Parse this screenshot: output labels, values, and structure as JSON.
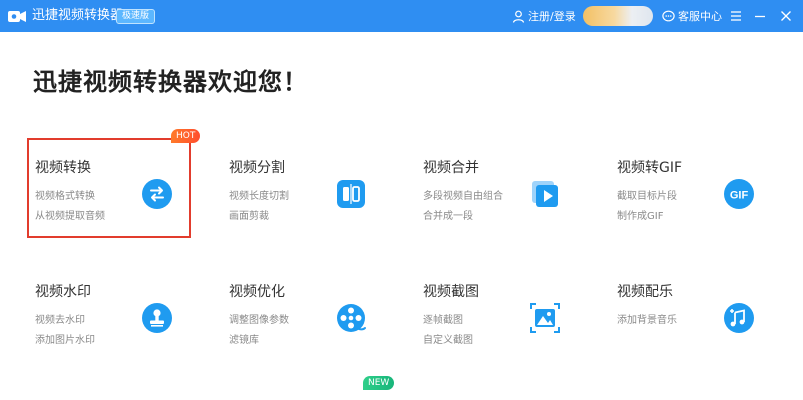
{
  "titlebar": {
    "app_name": "迅捷视频转换器",
    "edition_badge": "极速版",
    "login_label": "注册/登录",
    "service_label": "客服中心",
    "brand_color": "#2f8ef2"
  },
  "icons": {
    "app_logo": "camera-logo-icon",
    "login": "user-icon",
    "service": "chat-bubble-icon",
    "menu": "hamburger-menu-icon",
    "minimize": "minimize-icon",
    "close": "close-icon"
  },
  "main": {
    "welcome": "迅捷视频转换器欢迎您！",
    "hot_tag": "HOT",
    "new_tag": "NEW",
    "cards": [
      {
        "title": "视频转换",
        "desc1": "视频格式转换",
        "desc2": "从视频提取音频",
        "icon": "swap-arrows-icon",
        "selected": true
      },
      {
        "title": "视频分割",
        "desc1": "视频长度切割",
        "desc2": "画面剪裁",
        "icon": "split-icon"
      },
      {
        "title": "视频合并",
        "desc1": "多段视频自由组合",
        "desc2": "合并成一段",
        "icon": "merge-play-icon"
      },
      {
        "title": "视频转GIF",
        "desc1": "截取目标片段",
        "desc2": "制作成GIF",
        "icon": "gif-icon"
      },
      {
        "title": "视频水印",
        "desc1": "视频去水印",
        "desc2": "添加图片水印",
        "icon": "stamp-icon"
      },
      {
        "title": "视频优化",
        "desc1": "调整图像参数",
        "desc2": "滤镜库",
        "icon": "film-reel-icon"
      },
      {
        "title": "视频截图",
        "desc1": "逐帧截图",
        "desc2": "自定义截图",
        "icon": "screenshot-icon"
      },
      {
        "title": "视频配乐",
        "desc1": "添加背景音乐",
        "desc2": "",
        "icon": "music-add-icon"
      }
    ]
  }
}
